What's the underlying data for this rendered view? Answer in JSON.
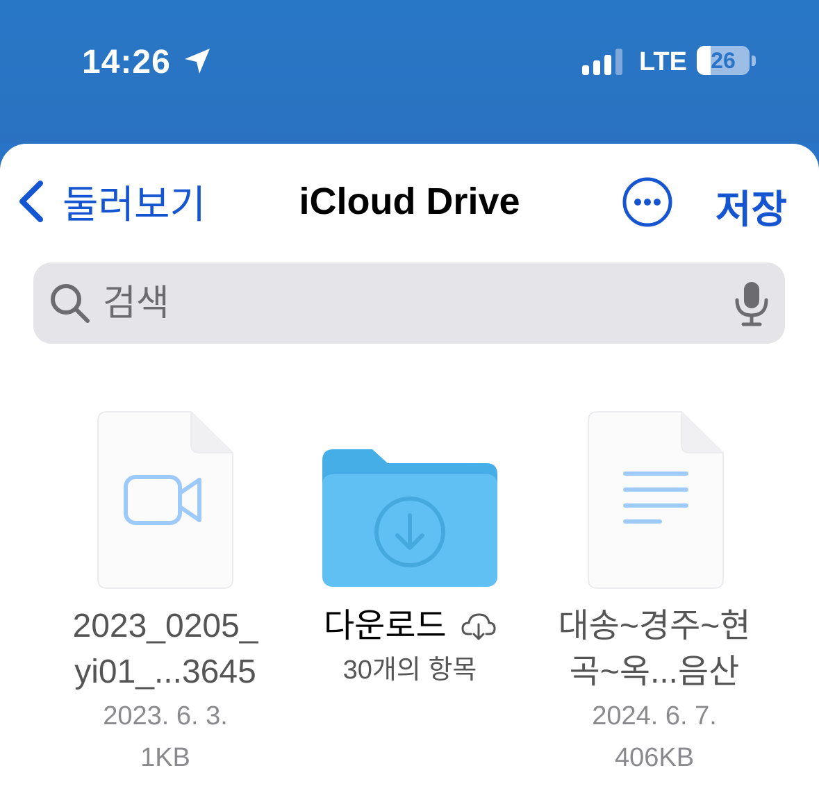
{
  "status_bar": {
    "time": "14:26",
    "network": "LTE",
    "battery_level": "26",
    "battery_fraction": 0.26,
    "signal_bars": 3
  },
  "nav": {
    "back_label": "둘러보기",
    "title": "iCloud Drive",
    "save_label": "저장"
  },
  "search": {
    "placeholder": "검색"
  },
  "items": [
    {
      "type": "video-file",
      "name_line1": "2023_0205_",
      "name_line2": "yi01_...3645",
      "date": "2023. 6. 3.",
      "size": "1KB"
    },
    {
      "type": "folder",
      "name": "다운로드",
      "count": "30개의 항목"
    },
    {
      "type": "text-file",
      "name_line1": "대송~경주~현",
      "name_line2": "곡~옥...음산",
      "date": "2024. 6. 7.",
      "size": "406KB"
    }
  ],
  "colors": {
    "header_blue": "#2a74c8",
    "accent": "#1555d1",
    "folder_blue": "#5bbbee"
  }
}
